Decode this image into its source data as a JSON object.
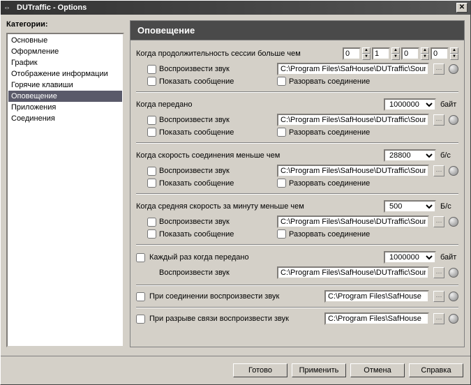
{
  "window": {
    "title": "DUTraffic - Options"
  },
  "sidebar": {
    "label": "Категории:",
    "items": [
      "Основные",
      "Оформление",
      "График",
      "Отображение информации",
      "Горячие клавиши",
      "Оповещение",
      "Приложения",
      "Соединения"
    ],
    "selected_index": 5
  },
  "panel": {
    "title": "Оповещение",
    "labels": {
      "play_sound": "Воспроизвести звук",
      "show_message": "Показать сообщение",
      "disconnect": "Разорвать соединение"
    },
    "sound_path": "C:\\Program Files\\SafHouse\\DUTraffic\\Sounds",
    "short_path": "C:\\Program Files\\SafHouse",
    "sections": [
      {
        "title": "Когда продолжительность сессии больше чем",
        "spins": [
          "0",
          "1",
          "0",
          "0"
        ]
      },
      {
        "title": "Когда передано",
        "value": "1000000",
        "unit": "байт"
      },
      {
        "title": "Когда скорость соединения меньше чем",
        "value": "28800",
        "unit": "б/с"
      },
      {
        "title": "Когда средняя скорость за минуту меньше чем",
        "value": "500",
        "unit": "Б/с"
      }
    ],
    "each_transfer": {
      "title": "Каждый раз когда передано",
      "value": "1000000",
      "unit": "байт",
      "play_label": "Воспроизвести звук"
    },
    "on_connect": "При соединении воспроизвести звук",
    "on_disconnect": "При разрыве связи воспроизвести звук"
  },
  "buttons": {
    "done": "Готово",
    "apply": "Применить",
    "cancel": "Отмена",
    "help": "Справка"
  }
}
